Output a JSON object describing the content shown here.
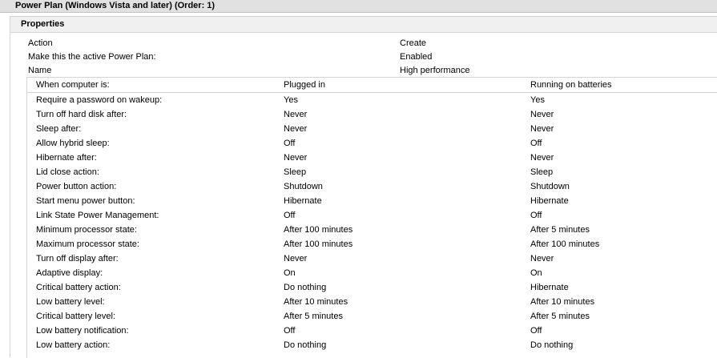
{
  "gpo": {
    "title": "Power Plan (Windows Vista and later) (Order: 1)"
  },
  "properties": {
    "title": "Properties",
    "fields": [
      {
        "label": "Action",
        "value": "Create"
      },
      {
        "label": "Make this the active Power Plan:",
        "value": "Enabled"
      },
      {
        "label": "Name",
        "value": "High performance"
      }
    ]
  },
  "table": {
    "headers": [
      "When computer is:",
      "Plugged in",
      "Running on batteries"
    ],
    "rows": [
      {
        "setting": "Require a password on wakeup:",
        "plugged": "Yes",
        "battery": "Yes"
      },
      {
        "setting": "Turn off hard disk after:",
        "plugged": "Never",
        "battery": "Never"
      },
      {
        "setting": "Sleep after:",
        "plugged": "Never",
        "battery": "Never"
      },
      {
        "setting": "Allow hybrid sleep:",
        "plugged": "Off",
        "battery": "Off"
      },
      {
        "setting": "Hibernate after:",
        "plugged": "Never",
        "battery": "Never"
      },
      {
        "setting": "Lid close action:",
        "plugged": "Sleep",
        "battery": "Sleep"
      },
      {
        "setting": "Power button action:",
        "plugged": "Shutdown",
        "battery": "Shutdown"
      },
      {
        "setting": "Start menu power button:",
        "plugged": "Hibernate",
        "battery": "Hibernate"
      },
      {
        "setting": "Link State Power Management:",
        "plugged": "Off",
        "battery": "Off"
      },
      {
        "setting": "Minimum processor state:",
        "plugged": "After 100 minutes",
        "battery": "After 5 minutes"
      },
      {
        "setting": "Maximum processor state:",
        "plugged": "After 100 minutes",
        "battery": "After 100 minutes"
      },
      {
        "setting": "Turn off display after:",
        "plugged": "Never",
        "battery": "Never"
      },
      {
        "setting": "Adaptive display:",
        "plugged": "On",
        "battery": "On"
      },
      {
        "setting": "Critical battery action:",
        "plugged": "Do nothing",
        "battery": "Hibernate"
      },
      {
        "setting": "Low battery level:",
        "plugged": "After 10 minutes",
        "battery": "After 10 minutes"
      },
      {
        "setting": "Critical battery level:",
        "plugged": "After 5 minutes",
        "battery": "After 5 minutes"
      },
      {
        "setting": "Low battery notification:",
        "plugged": "Off",
        "battery": "Off"
      },
      {
        "setting": "Low battery action:",
        "plugged": "Do nothing",
        "battery": "Do nothing"
      }
    ]
  }
}
